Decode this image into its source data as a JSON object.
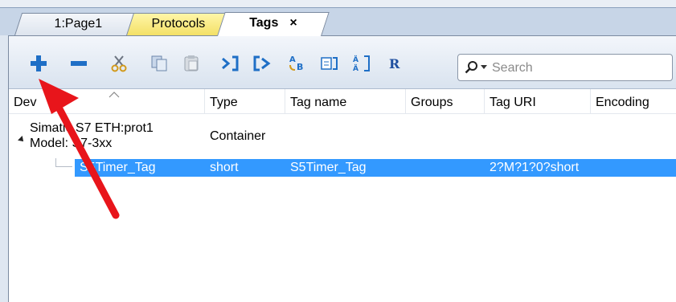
{
  "tabs": {
    "page1": "1:Page1",
    "protocols": "Protocols",
    "tags": "Tags",
    "tags_close": "×"
  },
  "toolbar": {
    "buttons": [
      "add-icon",
      "remove-icon",
      "cut-icon",
      "copy-icon",
      "paste-icon",
      "import-icon",
      "export-icon",
      "rename-icon",
      "edit-icon",
      "dictionary-icon",
      "r-icon"
    ],
    "search_placeholder": "Search"
  },
  "columns": {
    "device": "Dev",
    "type": "Type",
    "tag_name": "Tag name",
    "groups": "Groups",
    "tag_uri": "Tag URI",
    "encoding": "Encoding"
  },
  "rows": [
    {
      "device_line1": "Simatic S7 ETH:prot1",
      "device_line2": "Model: S7-3xx",
      "type": "Container"
    },
    {
      "device": "S5Timer_Tag",
      "type": "short",
      "tag_name": "S5Timer_Tag",
      "groups": "",
      "tag_uri": "2?M?1?0?short",
      "encoding": ""
    }
  ],
  "colors": {
    "accent_blue": "#1f6fc6",
    "selection": "#3399ff",
    "protocols_tab": "#f3e066",
    "annotation_arrow": "#e8151b"
  }
}
